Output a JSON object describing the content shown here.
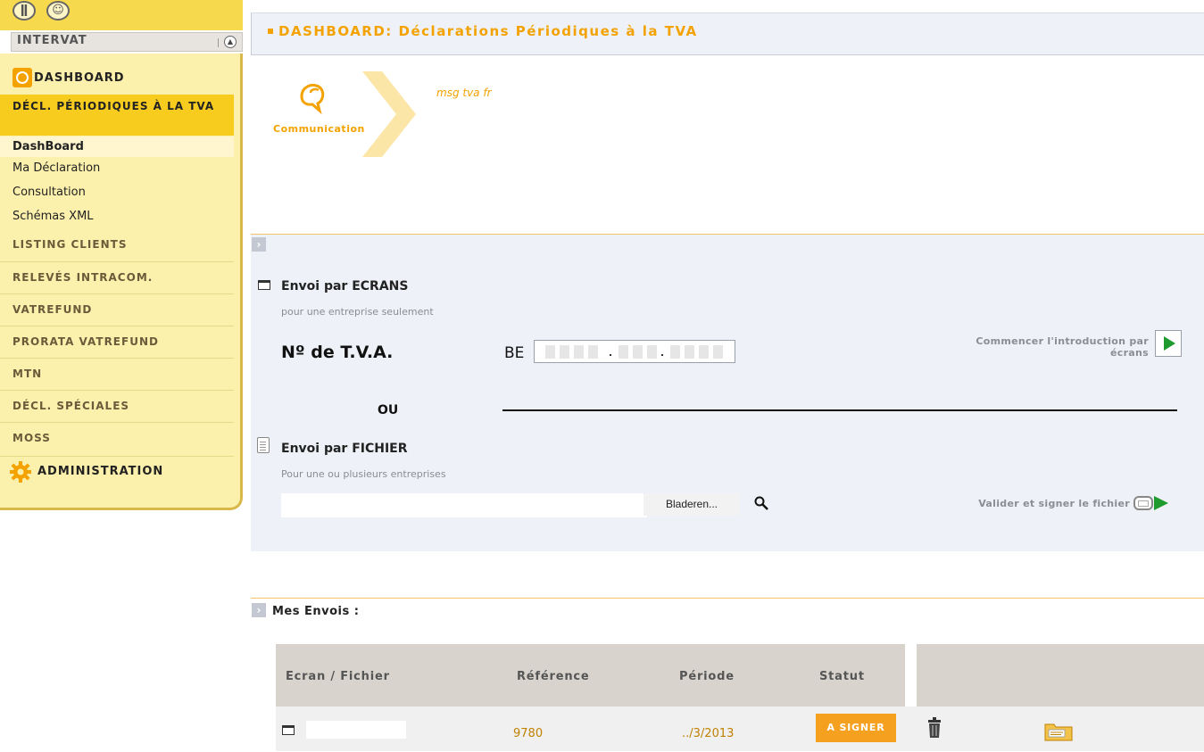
{
  "sidebar": {
    "top_icons": [
      "info-icon",
      "user-icon"
    ],
    "app_name": "INTERVAT",
    "dashboard_label": "DASHBOARD",
    "active_section": "DÉCL. PÉRIODIQUES À LA TVA",
    "subitems": [
      "DashBoard",
      "Ma Déclaration",
      "Consultation",
      "Schémas XML"
    ],
    "items": [
      "LISTING CLIENTS",
      "RELEVÉS INTRACOM.",
      "VATREFUND",
      "PRORATA VATREFUND",
      "MTN",
      "DÉCL. SPÉCIALES",
      "MOSS"
    ],
    "admin_label": "ADMINISTRATION"
  },
  "header": {
    "title": "DASHBOARD: Déclarations Périodiques à la TVA"
  },
  "communication": {
    "label": "Communication",
    "message": "msg tva fr"
  },
  "ecrans": {
    "title": "Envoi par ECRANS",
    "subtitle": "pour une entreprise seulement",
    "tva_label": "Nº de T.V.A.",
    "tva_prefix": "BE",
    "start_label_1": "Commencer l'introduction par",
    "start_label_2": "écrans"
  },
  "ou": "OU",
  "fichier": {
    "title": "Envoi par FICHIER",
    "subtitle": "Pour une ou plusieurs entreprises",
    "browse_label": "Bladeren...",
    "validate_label": "Valider et signer le fichier"
  },
  "envois": {
    "title": "Mes Envois :",
    "columns": [
      "Ecran / Fichier",
      "Référence",
      "Période",
      "Statut"
    ],
    "rows": [
      {
        "reference": "9780",
        "periode": "../3/2013",
        "statut": "A SIGNER"
      }
    ]
  },
  "colors": {
    "accent": "#f3a200",
    "sidebar": "#fcf1ac",
    "active": "#f7cc1e",
    "play": "#1e9a2e"
  }
}
